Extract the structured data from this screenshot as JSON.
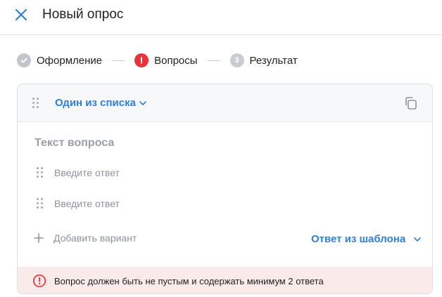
{
  "header": {
    "title": "Новый опрос",
    "close_icon": "close-icon"
  },
  "steps": [
    {
      "label": "Оформление",
      "state": "done",
      "icon": "check-circle-icon"
    },
    {
      "label": "Вопросы",
      "state": "error",
      "icon": "exclamation-circle-icon"
    },
    {
      "label": "Результат",
      "state": "pending",
      "number": "3"
    }
  ],
  "card": {
    "type_label": "Один из списка",
    "question_placeholder": "Текст вопроса",
    "answers": [
      {
        "placeholder": "Введите ответ"
      },
      {
        "placeholder": "Введите ответ"
      }
    ],
    "add_variant_label": "Добавить вариант",
    "template_label": "Ответ из шаблона",
    "error_message": "Вопрос должен быть не пустым и содержать минимум 2 ответа"
  },
  "colors": {
    "accent": "#2f7fd8",
    "error": "#e8333a",
    "error_bg": "#fbeaea",
    "muted": "#8d939b"
  }
}
